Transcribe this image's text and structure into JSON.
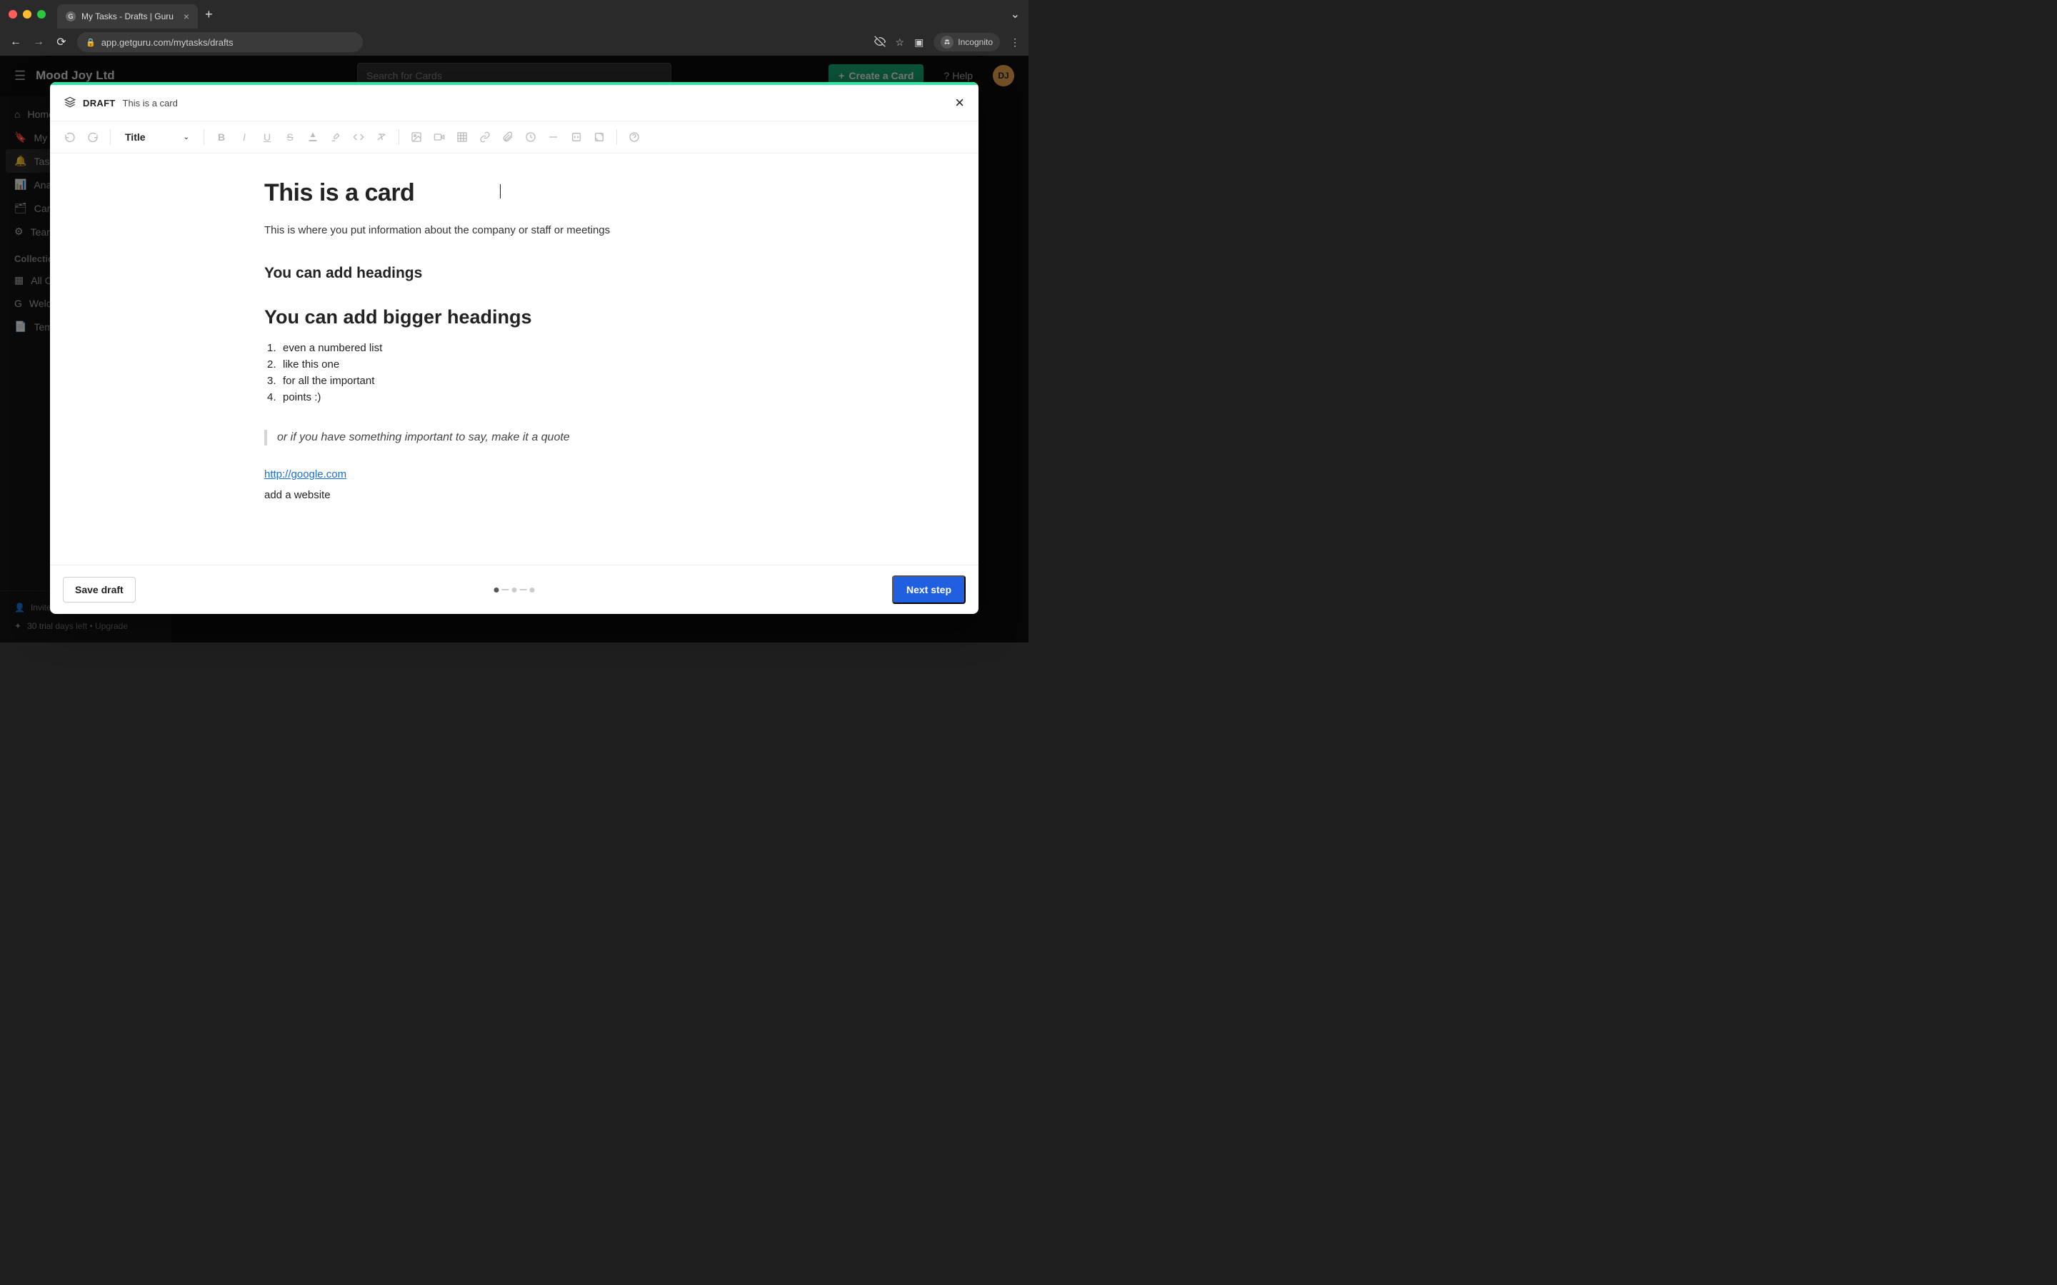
{
  "browser": {
    "tab_title": "My Tasks - Drafts | Guru",
    "url": "app.getguru.com/mytasks/drafts",
    "incognito_label": "Incognito"
  },
  "app": {
    "workspace": "Mood Joy Ltd",
    "search_placeholder": "Search for Cards",
    "create_card": "Create a Card",
    "help": "Help",
    "avatar_initials": "DJ",
    "sidebar": {
      "items": [
        {
          "icon": "home-icon",
          "label": "Home"
        },
        {
          "icon": "bookmark-icon",
          "label": "My Library"
        },
        {
          "icon": "bell-icon",
          "label": "Tasks"
        },
        {
          "icon": "chart-icon",
          "label": "Analytics"
        },
        {
          "icon": "cards-icon",
          "label": "Card Manager"
        },
        {
          "icon": "gear-icon",
          "label": "Team Settings"
        }
      ],
      "section_label": "Collections",
      "collections": [
        {
          "icon": "grid-icon",
          "label": "All Collections"
        },
        {
          "icon": "guru-icon",
          "label": "Welcome to Guru!"
        },
        {
          "icon": "template-icon",
          "label": "Templates"
        }
      ],
      "footer": {
        "invite": "Invite teammates",
        "trial": "30 trial days left • Upgrade"
      }
    }
  },
  "modal": {
    "badge": "DRAFT",
    "breadcrumb_title": "This is a card",
    "toolbar": {
      "style_select": "Title"
    },
    "content": {
      "title": "This is a card",
      "paragraph": "This is where you put information about the company or staff or meetings",
      "heading_small": "You can add headings",
      "heading_big": "You can add bigger headings",
      "list": [
        "even a numbered list",
        "like this one",
        "for all the important",
        "points :)"
      ],
      "quote": "or if you have something important to say, make it a quote",
      "link_text": "http://google.com",
      "link_caption": "add a website"
    },
    "footer": {
      "save_draft": "Save draft",
      "next_step": "Next step"
    }
  }
}
